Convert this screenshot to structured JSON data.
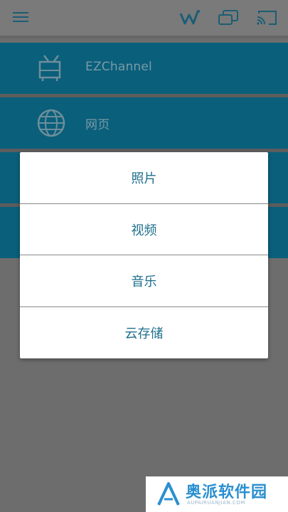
{
  "header": {
    "icons": [
      "menu-icon",
      "wifi-connect-icon",
      "screen-mirror-icon",
      "cast-icon"
    ]
  },
  "list": {
    "items": [
      {
        "label": "EZChannel",
        "icon": "tv-icon"
      },
      {
        "label": "网页",
        "icon": "globe-icon"
      },
      {
        "label": "",
        "icon": ""
      },
      {
        "label": "",
        "icon": ""
      }
    ]
  },
  "dialog": {
    "options": [
      {
        "label": "照片"
      },
      {
        "label": "视频"
      },
      {
        "label": "音乐"
      },
      {
        "label": "云存储"
      }
    ]
  },
  "watermark": {
    "brand": "奥派软件园",
    "sub": "AUPAIRUANJIAN.COM"
  },
  "colors": {
    "accent": "#0a5f7b",
    "dialog_text": "#1e6f8c",
    "overlay": "#6d6d6d"
  }
}
